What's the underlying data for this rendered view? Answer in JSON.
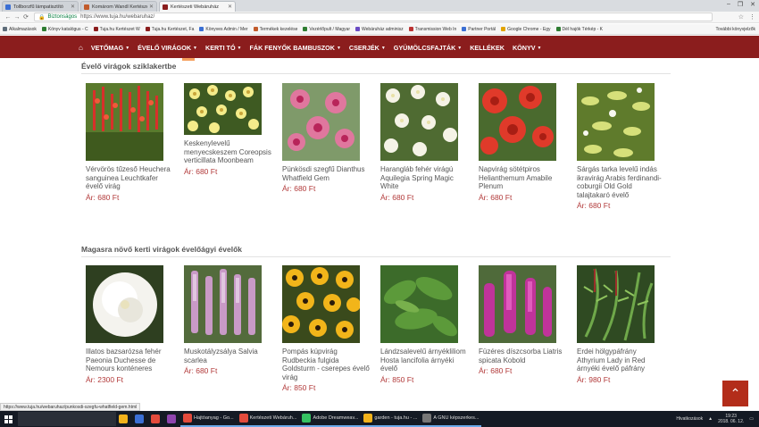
{
  "browser": {
    "tabs": [
      {
        "title": "Tollborzfű lámpatisztító",
        "active": false,
        "color": "#3b6fd4"
      },
      {
        "title": "Komárom Wandl Kertészet",
        "active": false,
        "color": "#c25b2b"
      },
      {
        "title": "Kertészeti Webáruház",
        "active": true,
        "color": "#8b1d1d"
      }
    ],
    "secure_label": "Biztonságos",
    "url": "https://www.tuja.hu/webaruhaz/",
    "bookmarks": [
      {
        "label": "Alkalmazások",
        "color": "#5f6d7a"
      },
      {
        "label": "Könyv katalógus - C",
        "color": "#2f7d32"
      },
      {
        "label": "Tuja.hu Kertészet W",
        "color": "#8b1d1d"
      },
      {
        "label": "Tuja.hu Kertészet, Fa",
        "color": "#8b1d1d"
      },
      {
        "label": "Könyves Admin / Mer",
        "color": "#3b6fd4"
      },
      {
        "label": "Termékek kezelése",
        "color": "#c25b2b"
      },
      {
        "label": "Vezérlőpult / Magyar",
        "color": "#2f7d32"
      },
      {
        "label": "Webáruház adminisz",
        "color": "#6a4bc4"
      },
      {
        "label": "Transmission Web In",
        "color": "#b33"
      },
      {
        "label": "Partner Portál",
        "color": "#3b6fd4"
      },
      {
        "label": "Google Chrome - Egy",
        "color": "#e2a400"
      },
      {
        "label": "Dél hajók Térkép - K",
        "color": "#2f7d32"
      }
    ],
    "bookmarks_more": "További könyvjelzők"
  },
  "nav": {
    "items": [
      {
        "label": "VETŐMAG",
        "dropdown": true
      },
      {
        "label": "ÉVELŐ VIRÁGOK",
        "dropdown": true
      },
      {
        "label": "KERTI TÓ",
        "dropdown": true
      },
      {
        "label": "FÁK FENYŐK BAMBUSZOK",
        "dropdown": true
      },
      {
        "label": "CSERJÉK",
        "dropdown": true
      },
      {
        "label": "GYÜMÖLCSFAJTÁK",
        "dropdown": true
      },
      {
        "label": "KELLÉKEK",
        "dropdown": false
      },
      {
        "label": "KÖNYV",
        "dropdown": true
      }
    ]
  },
  "sections": [
    {
      "title": "Évelő virágok sziklakertbe",
      "products": [
        {
          "name": "Vérvörös tűzeső Heuchera sanguinea Leuchtkafer évelő virág",
          "price": "Ár: 680 Ft",
          "img": "red-spikes"
        },
        {
          "name": "Keskenylevelű menyecskeszem Coreopsis verticillata Moonbeam",
          "price": "Ár: 680 Ft",
          "img": "yellow-daisy"
        },
        {
          "name": "Pünkösdi szegfű Dianthus Whatfield Gem",
          "price": "Ár: 680 Ft",
          "img": "pink-carnation"
        },
        {
          "name": "Harangláb fehér virágú Aquilegia Spring Magic White",
          "price": "Ár: 680 Ft",
          "img": "white-columbine"
        },
        {
          "name": "Napvirág sötétpiros Helianthemum Amabile Plenum",
          "price": "Ár: 680 Ft",
          "img": "red-rose"
        },
        {
          "name": "Sárgás tarka levelű indás ikravirág Arabis ferdinandi-coburgii Old Gold talajtakaró évelő",
          "price": "Ár: 680 Ft",
          "img": "variegated"
        }
      ]
    },
    {
      "title": "Magasra növő kerti virágok évelőágyi évelők",
      "products": [
        {
          "name": "Illatos bazsarózsa fehér Paeonia Duchesse de Nemours konténeres",
          "price": "Ár: 2300 Ft",
          "img": "white-peony"
        },
        {
          "name": "Muskotályzsálya Salvia scarlea",
          "price": "Ár: 680 Ft",
          "img": "salvia"
        },
        {
          "name": "Pompás kúpvirág Rudbeckia fulgida Goldsturm - cserepes évelő virág",
          "price": "Ár: 850 Ft",
          "img": "rudbeckia"
        },
        {
          "name": "Lándzsalevelű árnyékliliom Hosta lancifolia árnyéki évelő",
          "price": "Ár: 850 Ft",
          "img": "hosta"
        },
        {
          "name": "Füzéres díszcsorba Liatris spicata Kobold",
          "price": "Ár: 680 Ft",
          "img": "liatris"
        },
        {
          "name": "Erdei hölgypáfrány Athyrium Lady in Red árnyéki évelő páfrány",
          "price": "Ár: 980 Ft",
          "img": "fern"
        }
      ]
    }
  ],
  "status_url": "https://www.tuja.hu/webaruhaz/punkosdi-szegfu-whatfield-gem.html",
  "taskbar": {
    "items": [
      {
        "label": "",
        "color": "#f2b21b",
        "open": false
      },
      {
        "label": "",
        "color": "#3b6fd4",
        "open": false
      },
      {
        "label": "",
        "color": "#e34b3c",
        "open": false
      },
      {
        "label": "",
        "color": "#8e44ad",
        "open": false
      },
      {
        "label": "Hajtóanyag - Go...",
        "color": "#e34b3c",
        "open": true
      },
      {
        "label": "Kertészeti Webáruh...",
        "color": "#e34b3c",
        "open": true
      },
      {
        "label": "Adobe Dreamweav...",
        "color": "#35c262",
        "open": true
      },
      {
        "label": "garden - tuja.hu - ...",
        "color": "#f2b21b",
        "open": true
      },
      {
        "label": "A GNU képszerkes...",
        "color": "#777",
        "open": true
      }
    ],
    "tray_label": "Hivatkozások",
    "time": "19:23",
    "date": "2018. 06. 12."
  }
}
